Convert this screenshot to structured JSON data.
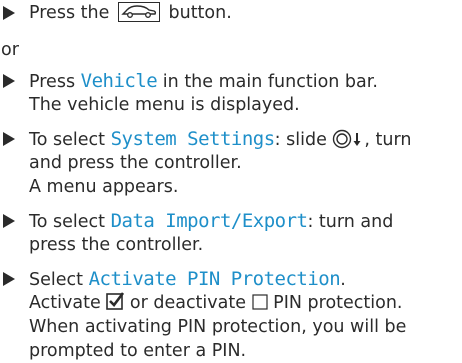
{
  "steps": {
    "s1": {
      "pre": "Press the",
      "post": "button.",
      "button_icon": "car-icon"
    },
    "or_label": "or",
    "s2": {
      "pre": "Press",
      "keyword": "Vehicle",
      "post": "in the main function bar.",
      "result": "The vehicle menu is displayed."
    },
    "s3": {
      "pre": "To select",
      "keyword": "System Settings",
      "post": ": slide",
      "post2": ", turn",
      "line2": "and press the controller.",
      "result": "A menu appears.",
      "controller_icon": "controller-slide-down-icon"
    },
    "s4": {
      "pre": "To select",
      "keyword": "Data Import/Export",
      "post": ": turn and",
      "line2": "press the controller."
    },
    "s5": {
      "pre": "Select",
      "keyword": "Activate PIN Protection",
      "post": ".",
      "line2_a": "Activate",
      "line2_b": "or deactivate",
      "line2_c": "PIN protection.",
      "line3": "When activating PIN protection, you will be",
      "line4": "prompted to enter a PIN.",
      "checked_icon": "checkbox-checked-icon",
      "unchecked_icon": "checkbox-unchecked-icon"
    }
  },
  "colors": {
    "keyword": "#1e8fc9",
    "text": "#2b2b2b"
  }
}
